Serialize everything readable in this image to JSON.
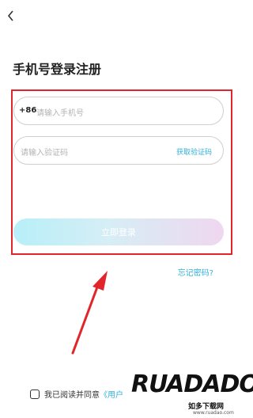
{
  "header": {
    "back_icon": "chevron-left-icon"
  },
  "page": {
    "title": "手机号登录注册"
  },
  "phone_field": {
    "prefix": "+86",
    "placeholder": "请输入手机号"
  },
  "code_field": {
    "placeholder": "请输入验证码",
    "get_code_label": "获取验证码"
  },
  "login_button": {
    "label": "立即登录"
  },
  "forgot_link": {
    "label": "忘记密码?"
  },
  "agreement": {
    "text": "我已阅读并同意",
    "link": "《用户"
  },
  "watermark": {
    "logo_text": "RUADADO",
    "sub_text": "如多下载网",
    "url": "www.ruadao.com"
  },
  "colors": {
    "accent": "#35b0d8",
    "annotation": "#e0262b"
  }
}
